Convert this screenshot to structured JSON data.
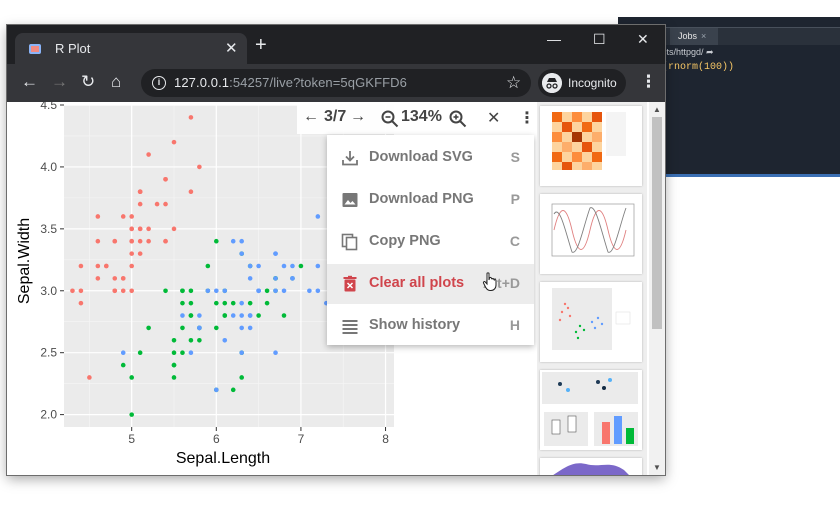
{
  "background_ide": {
    "tab_label": "Jobs",
    "path_text": "cts/httpgd/",
    "code_text": "(rnorm(100))"
  },
  "browser": {
    "tab_title": "R Plot",
    "url_host": "127.0.0.1",
    "url_rest": ":54257/live?token=5qGKFFD6",
    "incognito_label": "Incognito"
  },
  "plot_controls": {
    "page_indicator": "3/7",
    "zoom_level": "134%"
  },
  "menu": {
    "items": [
      {
        "label": "Download SVG",
        "shortcut": "S",
        "icon": "download-icon"
      },
      {
        "label": "Download PNG",
        "shortcut": "P",
        "icon": "image-icon"
      },
      {
        "label": "Copy PNG",
        "shortcut": "C",
        "icon": "copy-icon"
      },
      {
        "label": "Clear all plots",
        "shortcut": "Alt+D",
        "icon": "trash-icon"
      },
      {
        "label": "Show history",
        "shortcut": "H",
        "icon": "list-icon"
      }
    ]
  },
  "chart_data": {
    "type": "scatter",
    "xlabel": "Sepal.Length",
    "ylabel": "Sepal.Width",
    "x_ticks": [
      "5",
      "6",
      "7",
      "8"
    ],
    "y_ticks": [
      "2.0",
      "2.5",
      "3.0",
      "3.5",
      "4.0",
      "4.5"
    ],
    "xlim": [
      4.2,
      8.1
    ],
    "ylim": [
      1.9,
      4.5
    ],
    "grid": true,
    "series": [
      {
        "color": "#F8766D",
        "points": [
          [
            5.1,
            3.5
          ],
          [
            4.9,
            3.0
          ],
          [
            4.7,
            3.2
          ],
          [
            4.6,
            3.1
          ],
          [
            5.0,
            3.6
          ],
          [
            5.4,
            3.9
          ],
          [
            4.6,
            3.4
          ],
          [
            5.0,
            3.4
          ],
          [
            4.4,
            2.9
          ],
          [
            4.9,
            3.1
          ],
          [
            5.4,
            3.7
          ],
          [
            4.8,
            3.4
          ],
          [
            4.8,
            3.0
          ],
          [
            4.3,
            3.0
          ],
          [
            5.8,
            4.0
          ],
          [
            5.7,
            4.4
          ],
          [
            5.4,
            3.9
          ],
          [
            5.1,
            3.5
          ],
          [
            5.7,
            3.8
          ],
          [
            5.1,
            3.8
          ],
          [
            5.4,
            3.4
          ],
          [
            5.1,
            3.7
          ],
          [
            4.6,
            3.6
          ],
          [
            5.1,
            3.3
          ],
          [
            4.8,
            3.4
          ],
          [
            5.0,
            3.0
          ],
          [
            5.0,
            3.4
          ],
          [
            5.2,
            3.5
          ],
          [
            5.2,
            3.4
          ],
          [
            4.7,
            3.2
          ],
          [
            4.8,
            3.1
          ],
          [
            5.4,
            3.4
          ],
          [
            5.2,
            4.1
          ],
          [
            5.5,
            4.2
          ],
          [
            4.9,
            3.1
          ],
          [
            5.0,
            3.2
          ],
          [
            5.5,
            3.5
          ],
          [
            4.9,
            3.6
          ],
          [
            4.4,
            3.0
          ],
          [
            5.1,
            3.4
          ],
          [
            5.0,
            3.5
          ],
          [
            4.5,
            2.3
          ],
          [
            4.4,
            3.2
          ],
          [
            5.0,
            3.5
          ],
          [
            5.1,
            3.8
          ],
          [
            4.8,
            3.0
          ],
          [
            5.1,
            3.8
          ],
          [
            4.6,
            3.2
          ],
          [
            5.3,
            3.7
          ],
          [
            5.0,
            3.3
          ]
        ]
      },
      {
        "color": "#00BA38",
        "points": [
          [
            7.0,
            3.2
          ],
          [
            6.4,
            3.2
          ],
          [
            6.9,
            3.1
          ],
          [
            5.5,
            2.3
          ],
          [
            6.5,
            2.8
          ],
          [
            5.7,
            2.8
          ],
          [
            6.3,
            3.3
          ],
          [
            4.9,
            2.4
          ],
          [
            6.6,
            2.9
          ],
          [
            5.2,
            2.7
          ],
          [
            5.0,
            2.0
          ],
          [
            5.9,
            3.0
          ],
          [
            6.0,
            2.2
          ],
          [
            6.1,
            2.9
          ],
          [
            5.6,
            2.9
          ],
          [
            6.7,
            3.1
          ],
          [
            5.6,
            3.0
          ],
          [
            5.8,
            2.7
          ],
          [
            6.2,
            2.2
          ],
          [
            5.6,
            2.5
          ],
          [
            5.9,
            3.2
          ],
          [
            6.1,
            2.8
          ],
          [
            6.3,
            2.5
          ],
          [
            6.1,
            2.8
          ],
          [
            6.4,
            2.9
          ],
          [
            6.6,
            3.0
          ],
          [
            6.8,
            2.8
          ],
          [
            6.7,
            3.0
          ],
          [
            6.0,
            2.9
          ],
          [
            5.7,
            2.6
          ],
          [
            5.5,
            2.4
          ],
          [
            5.5,
            2.4
          ],
          [
            5.8,
            2.7
          ],
          [
            6.0,
            2.7
          ],
          [
            5.4,
            3.0
          ],
          [
            6.0,
            3.4
          ],
          [
            6.7,
            3.1
          ],
          [
            6.3,
            2.3
          ],
          [
            5.6,
            3.0
          ],
          [
            5.5,
            2.5
          ],
          [
            5.5,
            2.6
          ],
          [
            6.1,
            3.0
          ],
          [
            5.8,
            2.6
          ],
          [
            5.0,
            2.3
          ],
          [
            5.6,
            2.7
          ],
          [
            5.7,
            3.0
          ],
          [
            5.7,
            2.9
          ],
          [
            6.2,
            2.9
          ],
          [
            5.1,
            2.5
          ],
          [
            5.7,
            2.8
          ]
        ]
      },
      {
        "color": "#619CFF",
        "points": [
          [
            6.3,
            3.3
          ],
          [
            5.8,
            2.7
          ],
          [
            7.1,
            3.0
          ],
          [
            6.3,
            2.9
          ],
          [
            6.5,
            3.0
          ],
          [
            7.6,
            3.0
          ],
          [
            4.9,
            2.5
          ],
          [
            7.3,
            2.9
          ],
          [
            6.7,
            2.5
          ],
          [
            7.2,
            3.6
          ],
          [
            6.5,
            3.2
          ],
          [
            6.4,
            2.7
          ],
          [
            6.8,
            3.0
          ],
          [
            5.7,
            2.5
          ],
          [
            5.8,
            2.8
          ],
          [
            6.4,
            3.2
          ],
          [
            6.5,
            3.0
          ],
          [
            7.7,
            3.8
          ],
          [
            7.7,
            2.6
          ],
          [
            6.0,
            2.2
          ],
          [
            6.9,
            3.2
          ],
          [
            5.6,
            2.8
          ],
          [
            7.7,
            2.8
          ],
          [
            6.3,
            2.7
          ],
          [
            6.7,
            3.3
          ],
          [
            7.2,
            3.2
          ],
          [
            6.2,
            2.8
          ],
          [
            6.1,
            3.0
          ],
          [
            6.4,
            2.8
          ],
          [
            7.2,
            3.0
          ],
          [
            7.4,
            2.8
          ],
          [
            7.9,
            3.8
          ],
          [
            6.4,
            2.8
          ],
          [
            6.3,
            2.8
          ],
          [
            6.1,
            2.6
          ],
          [
            7.7,
            3.0
          ],
          [
            6.3,
            3.4
          ],
          [
            6.4,
            3.1
          ],
          [
            6.0,
            3.0
          ],
          [
            6.9,
            3.1
          ],
          [
            6.7,
            3.1
          ],
          [
            6.9,
            3.1
          ],
          [
            5.8,
            2.7
          ],
          [
            6.8,
            3.2
          ],
          [
            6.7,
            3.3
          ],
          [
            6.7,
            3.0
          ],
          [
            6.3,
            2.5
          ],
          [
            6.5,
            3.0
          ],
          [
            6.2,
            3.4
          ],
          [
            5.9,
            3.0
          ]
        ]
      }
    ]
  }
}
